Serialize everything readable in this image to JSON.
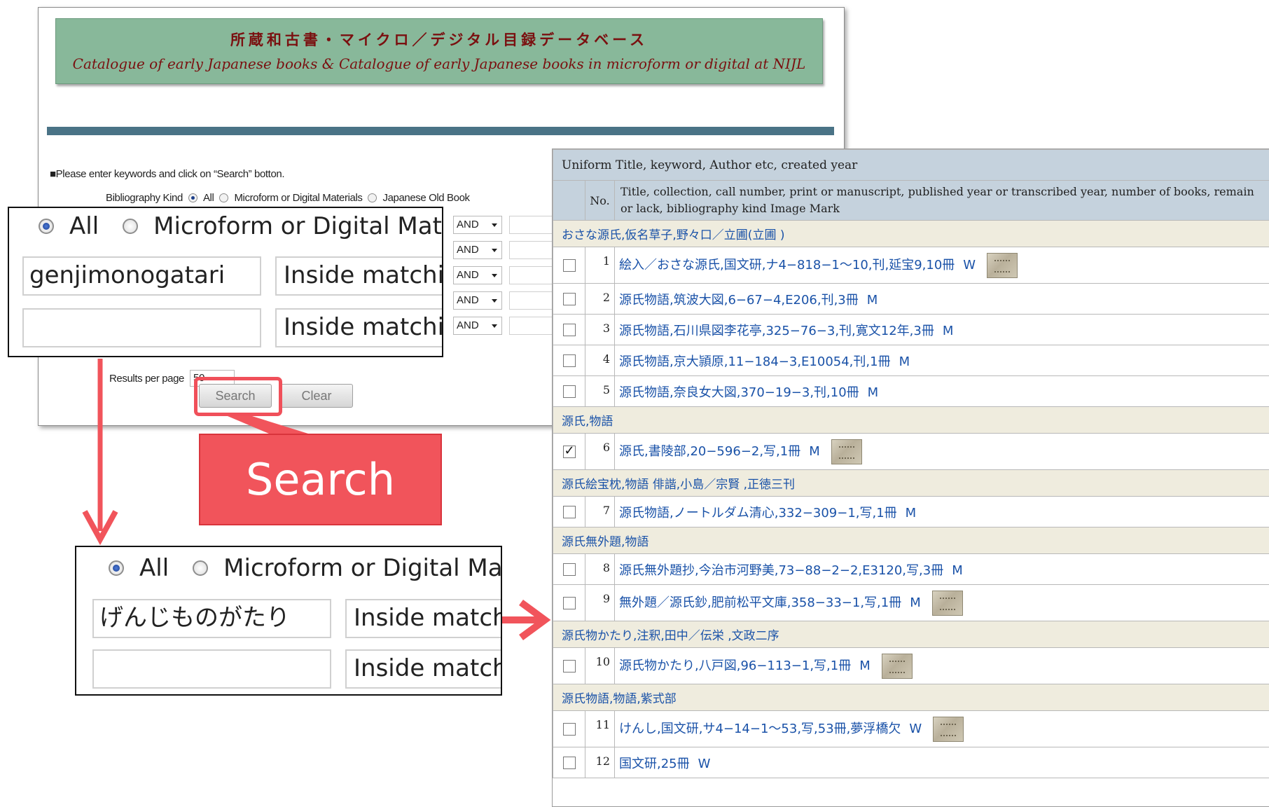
{
  "banner": {
    "title_jp": "所蔵和古書・マイクロ／デジタル目録データベース",
    "title_en": "Catalogue of early Japanese books & Catalogue of early Japanese books in microform or digital at NIJL"
  },
  "form": {
    "instruction": "■Please enter keywords and click on “Search” botton.",
    "kind_label": "Bibliography Kind",
    "kind_options": [
      "All",
      "Microform or Digital Materials",
      "Japanese Old Book"
    ],
    "operators": [
      "AND",
      "AND",
      "AND",
      "AND",
      "AND"
    ],
    "results_per_page_label": "Results per page",
    "results_per_page_value": "50",
    "search_button": "Search",
    "clear_button": "Clear"
  },
  "zoom_top": {
    "radio_all": "All",
    "radio_micro": "Microform or Digital Mate",
    "keyword1": "genjimonogatari",
    "match1": "Inside matchi",
    "keyword2": "",
    "match2": "Inside matchi"
  },
  "zoom_bottom": {
    "radio_all": "All",
    "radio_micro": "Microform or Digital Mat",
    "keyword1": "げんじものがたり",
    "match1": "Inside match",
    "keyword2": "",
    "match2": "Inside match"
  },
  "callout": {
    "label": "Search"
  },
  "results": {
    "header": "Uniform Title, keyword, Author etc, created year",
    "col_no": "No.",
    "col_desc": "Title, collection, call number, print or manuscript, published year or transcribed year, number of books, remain or lack, bibliography kind  Image Mark",
    "groups": [
      {
        "label": "おさな源氏,仮名草子,野々口／立圃(立圃 )"
      },
      {
        "label": "源氏,物語"
      },
      {
        "label": "源氏絵宝枕,物語 俳諧,小島／宗賢 ,正徳三刊"
      },
      {
        "label": "源氏無外題,物語"
      },
      {
        "label": "源氏物かたり,注釈,田中／伝栄 ,文政二序"
      },
      {
        "label": "源氏物語,物語,紫式部"
      }
    ],
    "rows": [
      {
        "no": "1",
        "text": "絵入／おさな源氏,国文研,ナ4−818−1〜10,刊,延宝9,10冊",
        "mark": "W",
        "checked": false
      },
      {
        "no": "2",
        "text": "源氏物語,筑波大図,6−67−4,E206,刊,3冊",
        "mark": "M",
        "checked": false
      },
      {
        "no": "3",
        "text": "源氏物語,石川県図李花亭,325−76−3,刊,寛文12年,3冊",
        "mark": "M",
        "checked": false
      },
      {
        "no": "4",
        "text": "源氏物語,京大頴原,11−184−3,E10054,刊,1冊",
        "mark": "M",
        "checked": false
      },
      {
        "no": "5",
        "text": "源氏物語,奈良女大図,370−19−3,刊,10冊",
        "mark": "M",
        "checked": false
      },
      {
        "no": "6",
        "text": "源氏,書陵部,20−596−2,写,1冊",
        "mark": "M",
        "checked": true
      },
      {
        "no": "7",
        "text": "源氏物語,ノートルダム清心,332−309−1,写,1冊",
        "mark": "M",
        "checked": false
      },
      {
        "no": "8",
        "text": "源氏無外題抄,今治市河野美,73−88−2−2,E3120,写,3冊",
        "mark": "M",
        "checked": false
      },
      {
        "no": "9",
        "text": "無外題／源氏鈔,肥前松平文庫,358−33−1,写,1冊",
        "mark": "M",
        "checked": false
      },
      {
        "no": "10",
        "text": "源氏物かたり,八戸図,96−113−1,写,1冊",
        "mark": "M",
        "checked": false
      },
      {
        "no": "11",
        "text": "けんし,国文研,サ4−14−1〜53,写,53冊,夢浮橋欠",
        "mark": "W",
        "checked": false
      },
      {
        "no": "12",
        "text": "国文研,25冊",
        "mark": "W",
        "checked": false
      }
    ]
  },
  "colors": {
    "banner_bg": "#88b89a",
    "banner_text": "#7a1010",
    "rule_bar": "#4a7386",
    "accent_red": "#f1545b",
    "link_blue": "#1a52a8",
    "table_header": "#c5d2dd",
    "group_row": "#efecde"
  }
}
